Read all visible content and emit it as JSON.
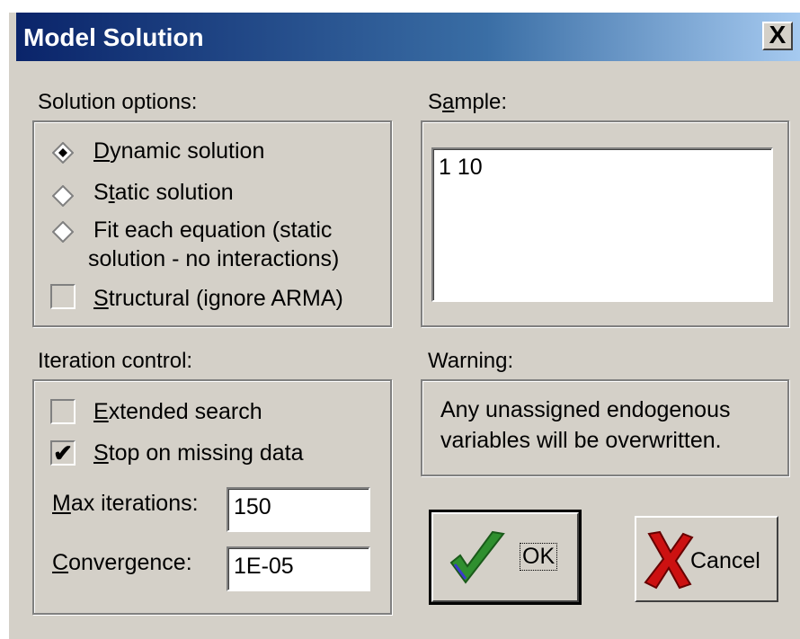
{
  "window": {
    "title": "Model Solution",
    "close_glyph": "X"
  },
  "solution_options": {
    "label": "Solution options:",
    "dynamic": {
      "prefix": "",
      "key": "D",
      "rest": "ynamic solution",
      "selected": true
    },
    "static": {
      "prefix": "S",
      "key": "t",
      "rest": "atic solution",
      "selected": false
    },
    "fit_line1": "Fit each equation (static",
    "fit_line2": "solution - no interactions)",
    "structural": {
      "key": "S",
      "rest": "tructural (ignore ARMA)",
      "checked": false
    }
  },
  "sample": {
    "label_pre": "S",
    "label_key": "a",
    "label_post": "mple:",
    "value": "1 10"
  },
  "iteration": {
    "label": "Iteration control:",
    "extended": {
      "key": "E",
      "rest": "xtended search",
      "checked": false
    },
    "stop": {
      "key": "",
      "pre": "",
      "text_key": "S",
      "rest": "top on missing data",
      "checked": true,
      "check_glyph": "✔"
    },
    "max_label_key": "M",
    "max_label_rest": "ax iterations:",
    "max_value": "150",
    "conv_label_key": "C",
    "conv_label_rest": "onvergence:",
    "conv_value": "1E-05"
  },
  "warning": {
    "label": "Warning:",
    "line1": "Any unassigned endogenous",
    "line2": "variables will be overwritten."
  },
  "buttons": {
    "ok": "OK",
    "cancel": "Cancel"
  },
  "colors": {
    "face": "#d4d0c8",
    "title_start": "#0a246a",
    "ok_check": "#2f8f2f",
    "cancel_x": "#cc1111"
  }
}
